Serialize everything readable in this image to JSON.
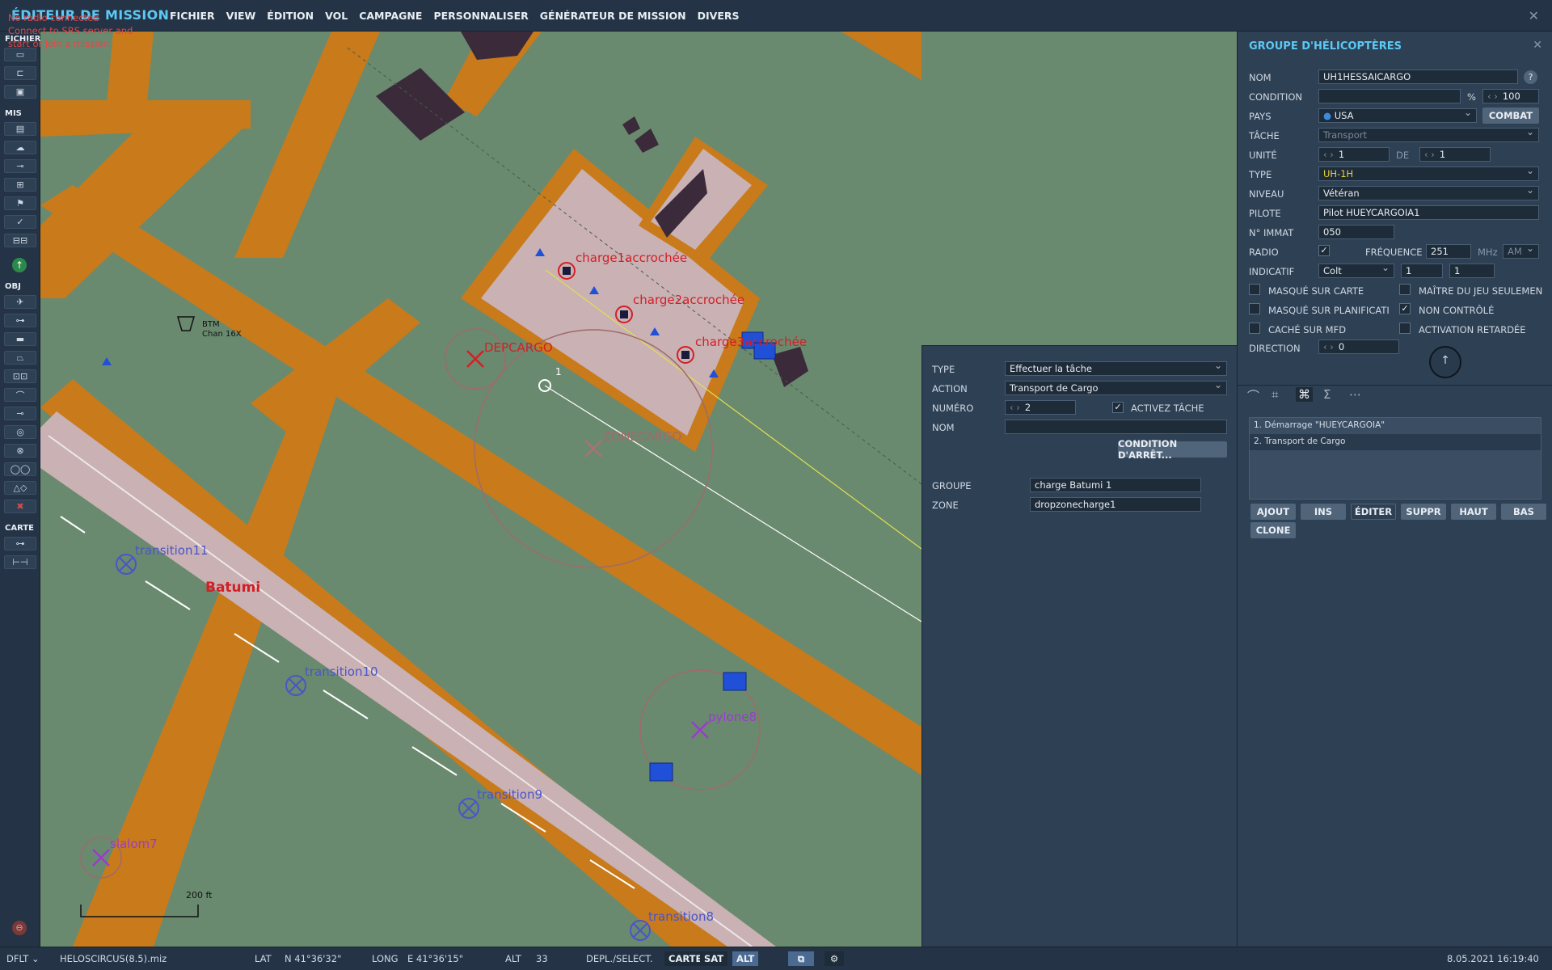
{
  "app": {
    "title": "ÉDITEUR DE MISSION",
    "srs_lines": [
      "No radio connected",
      "Connect to SRS server and",
      "start or join a mission"
    ]
  },
  "menu": [
    "FICHIER",
    "VIEW",
    "ÉDITION",
    "VOL",
    "CAMPAGNE",
    "PERSONNALISER",
    "GÉNÉRATEUR DE MISSION",
    "DIVERS"
  ],
  "sidebar": {
    "sections": [
      "FICHIER",
      "MIS",
      "OBJ",
      "CARTE"
    ]
  },
  "map": {
    "labels": {
      "charge1": "charge1accrochée",
      "charge2": "charge2accrochée",
      "charge3": "charge3accrochée",
      "depcargo": "DEPCARGO",
      "zonecargo": "ZONECARGO",
      "wp1": "1",
      "btm": "BTM",
      "btm_chan": "Chan 16X",
      "batumi": "Batumi",
      "transition11": "transition11",
      "transition10": "transition10",
      "transition9": "transition9",
      "transition8": "transition8",
      "pylone8": "pylone8",
      "slalom7": "slalom7",
      "scale": "200 ft"
    },
    "colors": {
      "road": "#c97a1a",
      "tarmac": "#c9b1b4",
      "grass": "#6a8a6f",
      "route": "#e0e050"
    }
  },
  "task": {
    "type_label": "TYPE",
    "type_value": "Effectuer la tâche",
    "action_label": "ACTION",
    "action_value": "Transport de Cargo",
    "numero_label": "NUMÉRO",
    "numero_value": "2",
    "activez_label": "ACTIVEZ TÂCHE",
    "nom_label": "NOM",
    "nom_value": "",
    "stop_condition": "CONDITION D'ARRÊT...",
    "groupe_label": "GROUPE",
    "groupe_value": "charge Batumi 1",
    "zone_label": "ZONE",
    "zone_value": "dropzonecharge1"
  },
  "group": {
    "title": "GROUPE D'HÉLICOPTÈRES",
    "nom_label": "NOM",
    "nom_value": "UH1HESSAICARGO",
    "condition_label": "CONDITION",
    "condition_pct": "%",
    "condition_value": "100",
    "pays_label": "PAYS",
    "pays_value": "USA",
    "combat": "COMBAT",
    "tache_label": "TÂCHE",
    "tache_value": "Transport",
    "unite_label": "UNITÉ",
    "unite_value": "1",
    "de_label": "DE",
    "de_value": "1",
    "type_label": "TYPE",
    "type_value": "UH-1H",
    "niveau_label": "NIVEAU",
    "niveau_value": "Vétéran",
    "pilote_label": "PILOTE",
    "pilote_value": "Pilot HUEYCARGOIA1",
    "immat_label": "N° IMMAT",
    "immat_value": "050",
    "radio_label": "RADIO",
    "freq_label": "FRÉQUENCE",
    "freq_value": "251",
    "mhz": "MHz",
    "am": "AM",
    "indicatif_label": "INDICATIF",
    "indicatif_value": "Colt",
    "indicatif_n1": "1",
    "indicatif_n2": "1",
    "masque_carte": "MASQUÉ SUR CARTE",
    "maitre_jeu": "MAÎTRE DU JEU SEULEMEN",
    "masque_planif": "MASQUÉ SUR PLANIFICATI",
    "non_controle": "NON CONTRÔLÉ",
    "cache_mfd": "CACHÉ SUR MFD",
    "activation": "ACTIVATION RETARDÉE",
    "direction_label": "DIRECTION",
    "direction_value": "0",
    "tasks": [
      "1. Démarrage \"HUEYCARGOIA\"",
      "2. Transport de Cargo"
    ],
    "buttons": [
      "AJOUT",
      "INS",
      "ÉDITER",
      "SUPPR",
      "HAUT",
      "BAS",
      "CLONE"
    ]
  },
  "status": {
    "profile": "DFLT",
    "file": "HELOSCIRCUS(8.5).miz",
    "lat_label": "LAT",
    "lat_value": "N 41°36'32\"",
    "long_label": "LONG",
    "long_value": "E 41°36'15\"",
    "alt_label": "ALT",
    "alt_value": "33",
    "mode": "DEPL./SELECT.",
    "carte": "CARTE",
    "sat": "SAT",
    "alt_btn": "ALT",
    "datetime": "8.05.2021 16:19:40"
  }
}
